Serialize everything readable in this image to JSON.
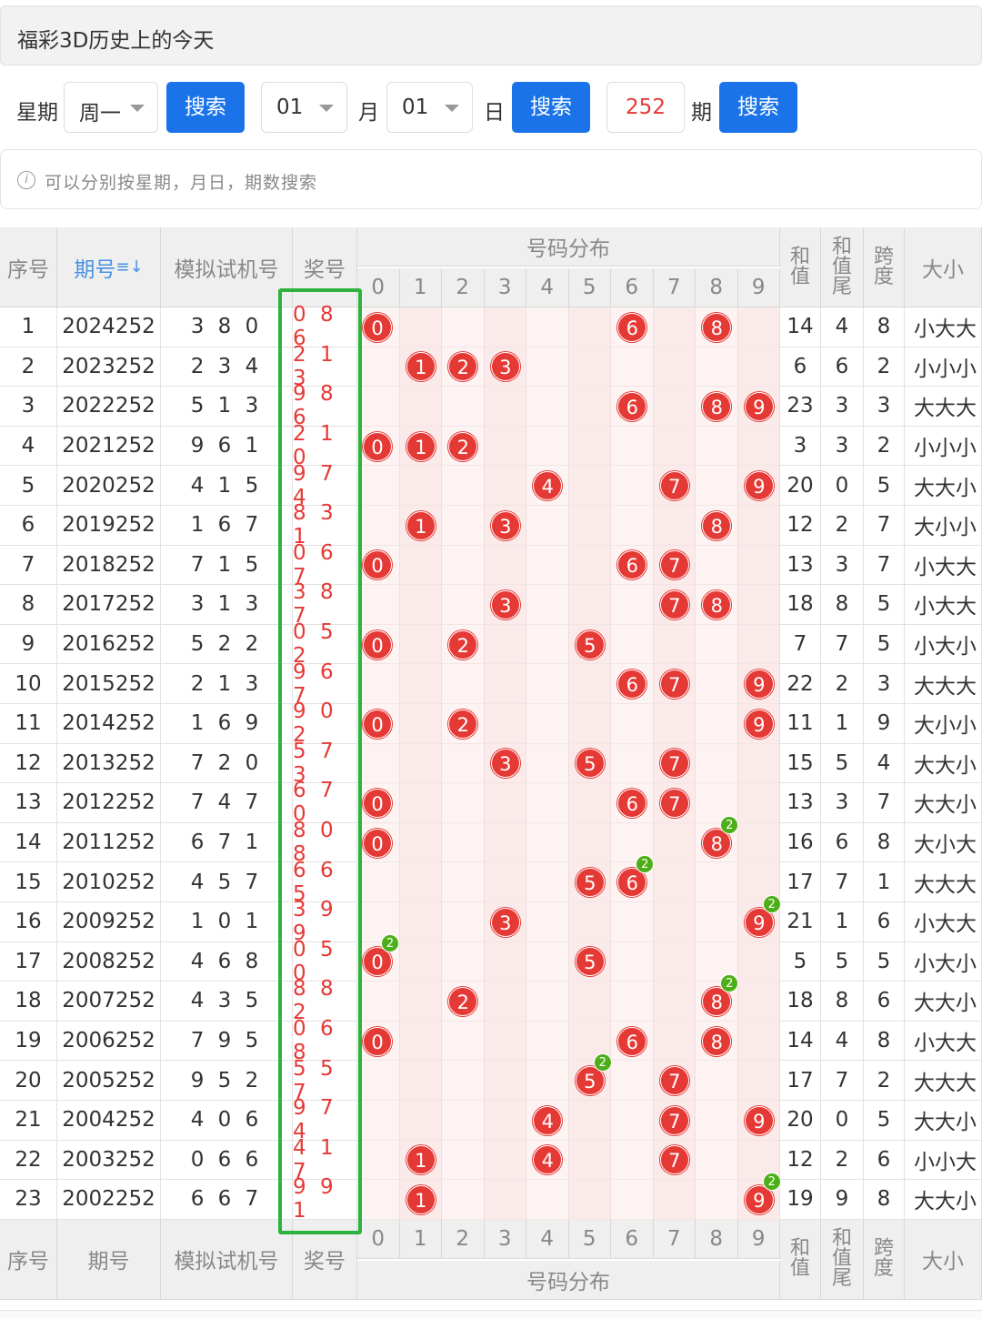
{
  "header": {
    "title": "福彩3D历史上的今天"
  },
  "search": {
    "weekday_label": "星期",
    "weekday_value": "周一",
    "search_label": "搜索",
    "month_value": "01",
    "month_label": "月",
    "day_value": "01",
    "day_label": "日",
    "issue_value": "252",
    "issue_label": "期"
  },
  "tip": {
    "icon": "info-icon",
    "text": "可以分别按星期，月日，期数搜索"
  },
  "table": {
    "headers": {
      "seq": "序号",
      "issue": "期号",
      "sort_icon": "≡↓",
      "sim": "模拟试机号",
      "prize": "奖号",
      "dist": "号码分布",
      "sum": "和值",
      "sumtail": "和值尾",
      "span": "跨度",
      "size": "大小"
    },
    "digits": [
      "0",
      "1",
      "2",
      "3",
      "4",
      "5",
      "6",
      "7",
      "8",
      "9"
    ],
    "rows": [
      {
        "seq": "1",
        "issue": "2024252",
        "sim": "3 8 0",
        "prize": "0 8 6",
        "d": [
          0,
          8,
          6
        ],
        "sum": "14",
        "tail": "4",
        "span": "8",
        "size": "小大大"
      },
      {
        "seq": "2",
        "issue": "2023252",
        "sim": "2 3 4",
        "prize": "2 1 3",
        "d": [
          2,
          1,
          3
        ],
        "sum": "6",
        "tail": "6",
        "span": "2",
        "size": "小小小"
      },
      {
        "seq": "3",
        "issue": "2022252",
        "sim": "5 1 3",
        "prize": "9 8 6",
        "d": [
          9,
          8,
          6
        ],
        "sum": "23",
        "tail": "3",
        "span": "3",
        "size": "大大大"
      },
      {
        "seq": "4",
        "issue": "2021252",
        "sim": "9 6 1",
        "prize": "2 1 0",
        "d": [
          2,
          1,
          0
        ],
        "sum": "3",
        "tail": "3",
        "span": "2",
        "size": "小小小"
      },
      {
        "seq": "5",
        "issue": "2020252",
        "sim": "4 1 5",
        "prize": "9 7 4",
        "d": [
          9,
          7,
          4
        ],
        "sum": "20",
        "tail": "0",
        "span": "5",
        "size": "大大小"
      },
      {
        "seq": "6",
        "issue": "2019252",
        "sim": "1 6 7",
        "prize": "8 3 1",
        "d": [
          8,
          3,
          1
        ],
        "sum": "12",
        "tail": "2",
        "span": "7",
        "size": "大小小"
      },
      {
        "seq": "7",
        "issue": "2018252",
        "sim": "7 1 5",
        "prize": "0 6 7",
        "d": [
          0,
          6,
          7
        ],
        "sum": "13",
        "tail": "3",
        "span": "7",
        "size": "小大大"
      },
      {
        "seq": "8",
        "issue": "2017252",
        "sim": "3 1 3",
        "prize": "3 8 7",
        "d": [
          3,
          8,
          7
        ],
        "sum": "18",
        "tail": "8",
        "span": "5",
        "size": "小大大"
      },
      {
        "seq": "9",
        "issue": "2016252",
        "sim": "5 2 2",
        "prize": "0 5 2",
        "d": [
          0,
          5,
          2
        ],
        "sum": "7",
        "tail": "7",
        "span": "5",
        "size": "小大小"
      },
      {
        "seq": "10",
        "issue": "2015252",
        "sim": "2 1 3",
        "prize": "9 6 7",
        "d": [
          9,
          6,
          7
        ],
        "sum": "22",
        "tail": "2",
        "span": "3",
        "size": "大大大"
      },
      {
        "seq": "11",
        "issue": "2014252",
        "sim": "1 6 9",
        "prize": "9 0 2",
        "d": [
          9,
          0,
          2
        ],
        "sum": "11",
        "tail": "1",
        "span": "9",
        "size": "大小小"
      },
      {
        "seq": "12",
        "issue": "2013252",
        "sim": "7 2 0",
        "prize": "5 7 3",
        "d": [
          5,
          7,
          3
        ],
        "sum": "15",
        "tail": "5",
        "span": "4",
        "size": "大大小"
      },
      {
        "seq": "13",
        "issue": "2012252",
        "sim": "7 4 7",
        "prize": "6 7 0",
        "d": [
          6,
          7,
          0
        ],
        "sum": "13",
        "tail": "3",
        "span": "7",
        "size": "大大小"
      },
      {
        "seq": "14",
        "issue": "2011252",
        "sim": "6 7 1",
        "prize": "8 0 8",
        "d": [
          8,
          0,
          8
        ],
        "sum": "16",
        "tail": "6",
        "span": "8",
        "size": "大小大"
      },
      {
        "seq": "15",
        "issue": "2010252",
        "sim": "4 5 7",
        "prize": "6 6 5",
        "d": [
          6,
          6,
          5
        ],
        "sum": "17",
        "tail": "7",
        "span": "1",
        "size": "大大大"
      },
      {
        "seq": "16",
        "issue": "2009252",
        "sim": "1 0 1",
        "prize": "3 9 9",
        "d": [
          3,
          9,
          9
        ],
        "sum": "21",
        "tail": "1",
        "span": "6",
        "size": "小大大"
      },
      {
        "seq": "17",
        "issue": "2008252",
        "sim": "4 6 8",
        "prize": "0 5 0",
        "d": [
          0,
          5,
          0
        ],
        "sum": "5",
        "tail": "5",
        "span": "5",
        "size": "小大小"
      },
      {
        "seq": "18",
        "issue": "2007252",
        "sim": "4 3 5",
        "prize": "8 8 2",
        "d": [
          8,
          8,
          2
        ],
        "sum": "18",
        "tail": "8",
        "span": "6",
        "size": "大大小"
      },
      {
        "seq": "19",
        "issue": "2006252",
        "sim": "7 9 5",
        "prize": "0 6 8",
        "d": [
          0,
          6,
          8
        ],
        "sum": "14",
        "tail": "4",
        "span": "8",
        "size": "小大大"
      },
      {
        "seq": "20",
        "issue": "2005252",
        "sim": "9 5 2",
        "prize": "5 5 7",
        "d": [
          5,
          5,
          7
        ],
        "sum": "17",
        "tail": "7",
        "span": "2",
        "size": "大大大"
      },
      {
        "seq": "21",
        "issue": "2004252",
        "sim": "4 0 6",
        "prize": "9 7 4",
        "d": [
          9,
          7,
          4
        ],
        "sum": "20",
        "tail": "0",
        "span": "5",
        "size": "大大小"
      },
      {
        "seq": "22",
        "issue": "2003252",
        "sim": "0 6 6",
        "prize": "4 1 7",
        "d": [
          4,
          1,
          7
        ],
        "sum": "12",
        "tail": "2",
        "span": "6",
        "size": "小小大"
      },
      {
        "seq": "23",
        "issue": "2002252",
        "sim": "6 6 7",
        "prize": "9 9 1",
        "d": [
          9,
          9,
          1
        ],
        "sum": "19",
        "tail": "9",
        "span": "8",
        "size": "大大小"
      }
    ]
  },
  "colors": {
    "primary": "#1a73e8",
    "prize": "#e53935",
    "highlight": "#2db33d",
    "badge": "#4caf18"
  }
}
